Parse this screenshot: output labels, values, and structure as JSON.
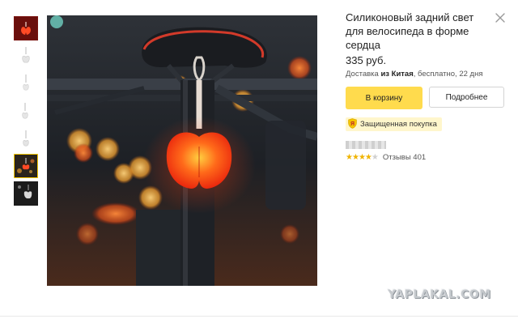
{
  "product": {
    "title": "Силиконовый задний свет для велосипеда в форме сердца",
    "price": "335 руб.",
    "delivery_prefix": "Доставка ",
    "delivery_from": "из Китая",
    "delivery_suffix": ", бесплатно, 22 дня"
  },
  "actions": {
    "cart_label": "В корзину",
    "details_label": "Подробнее"
  },
  "badge": {
    "secure_label": "Защищенная покупка",
    "icon_letter": "Я"
  },
  "rating": {
    "stars": 4,
    "max_stars": 5,
    "reviews_label": "Отзывы 401"
  },
  "gallery": {
    "thumbnail_count": 7,
    "active_index": 5
  },
  "watermark": "YAPLAKAL.COM",
  "colors": {
    "accent_yellow": "#ffdb4d",
    "badge_bg": "#fff6cc",
    "star": "#f0b400",
    "light_red": "#ff3a1a"
  },
  "icons": {
    "close": "close-icon",
    "shield": "shield-ya-icon",
    "star": "star-icon"
  }
}
